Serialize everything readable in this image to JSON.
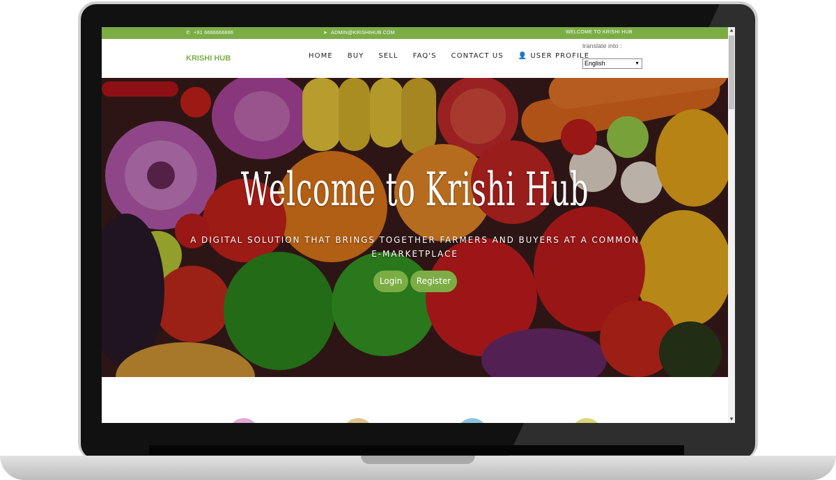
{
  "topbar": {
    "phone": "+91 6666666666",
    "email": "ADMIN@KRISHIHUB.COM",
    "welcome": "WELCOME TO KRISHI HUB"
  },
  "navbar": {
    "brand": "KRISHI HUB",
    "links": [
      "HOME",
      "BUY",
      "SELL",
      "FAQ'S",
      "CONTACT US",
      "USER PROFILE"
    ],
    "translate_label": "translate into :",
    "language_selected": "English"
  },
  "hero": {
    "title": "Welcome to Krishi Hub",
    "subtitle": "A DIGITAL SOLUTION THAT BRINGS TOGETHER FARMERS AND BUYERS AT A COMMON E-MARKETPLACE",
    "login_label": "Login",
    "register_label": "Register"
  },
  "colors": {
    "accent": "#7cad45",
    "circle_1": "#e2a8d8",
    "circle_2": "#e0c58c",
    "circle_3": "#8cc6e0",
    "circle_4": "#d9d77a"
  }
}
